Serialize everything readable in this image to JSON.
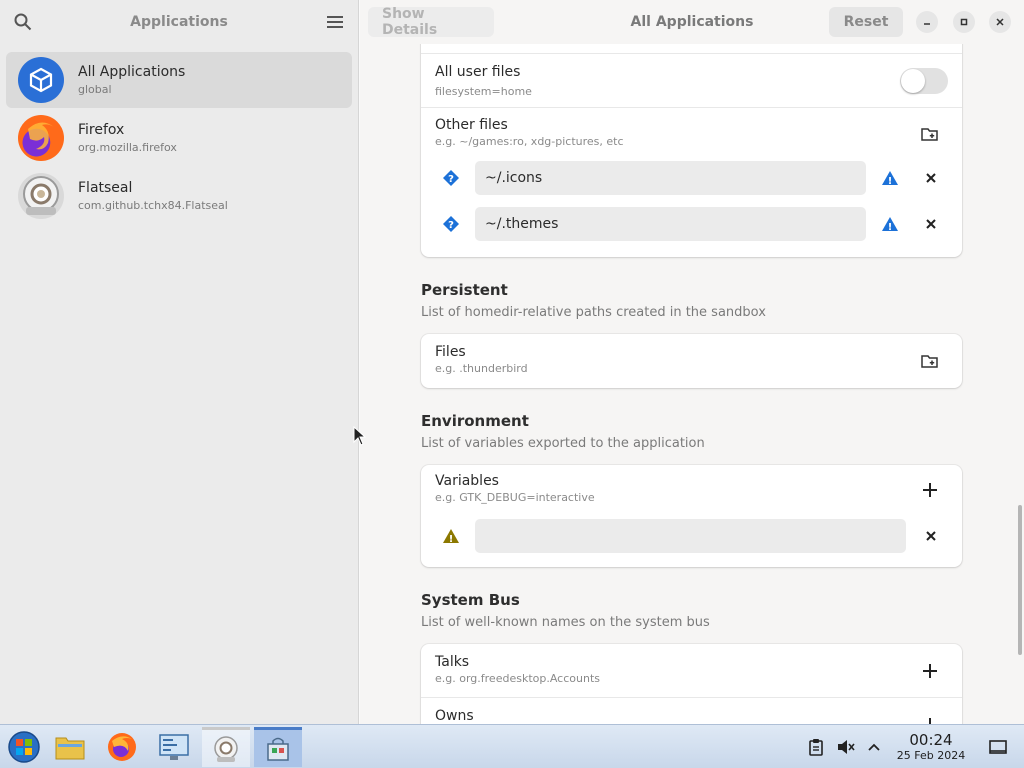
{
  "sidebar": {
    "title": "Applications",
    "apps": [
      {
        "name": "All Applications",
        "id": "global",
        "selected": true
      },
      {
        "name": "Firefox",
        "id": "org.mozilla.firefox"
      },
      {
        "name": "Flatseal",
        "id": "com.github.tchx84.Flatseal"
      }
    ]
  },
  "header": {
    "show_details": "Show Details",
    "title": "All Applications",
    "reset": "Reset"
  },
  "filesystem": {
    "all_user_files": {
      "title": "All user files",
      "subtitle": "filesystem=home",
      "enabled": false
    },
    "other_files": {
      "title": "Other files",
      "subtitle": "e.g. ~/games:ro, xdg-pictures, etc"
    },
    "entries": [
      "~/.icons",
      "~/.themes"
    ]
  },
  "persistent": {
    "title": "Persistent",
    "description": "List of homedir-relative paths created in the sandbox",
    "files": {
      "title": "Files",
      "subtitle": "e.g. .thunderbird"
    }
  },
  "environment": {
    "title": "Environment",
    "description": "List of variables exported to the application",
    "variables": {
      "title": "Variables",
      "subtitle": "e.g. GTK_DEBUG=interactive"
    },
    "entry_value": ""
  },
  "system_bus": {
    "title": "System Bus",
    "description": "List of well-known names on the system bus",
    "talks": {
      "title": "Talks",
      "subtitle": "e.g. org.freedesktop.Accounts"
    },
    "owns": {
      "title": "Owns"
    }
  },
  "taskbar": {
    "time": "00:24",
    "date": "25 Feb 2024",
    "items": [
      "start-orb-icon",
      "file-manager-icon",
      "firefox-icon",
      "control-panel-icon",
      "flatseal-icon",
      "store-icon"
    ]
  },
  "colors": {
    "accent": "#1c71d8",
    "warning": "#9a7b00",
    "sidebar_bg": "#ebebeb"
  }
}
